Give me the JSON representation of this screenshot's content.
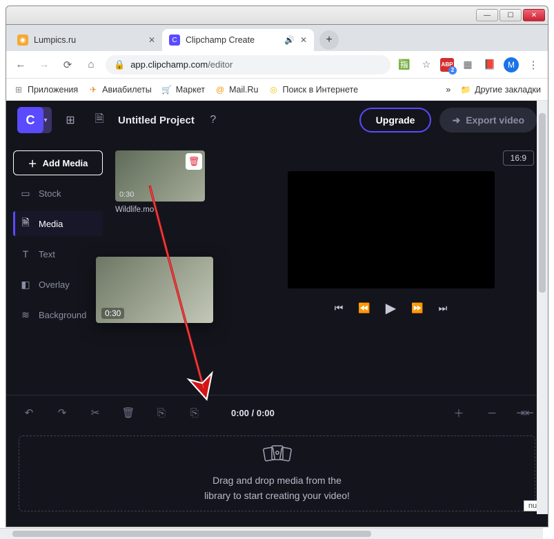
{
  "window": {
    "tabs": [
      {
        "title": "Lumpics.ru",
        "favicon_color": "#f4a934"
      },
      {
        "title": "Clipchamp Create",
        "favicon_color": "#5a4bff",
        "favicon_letter": "C",
        "audio": true
      }
    ]
  },
  "address_bar": {
    "lock": "🔒",
    "host": "app.clipchamp.com",
    "path": "/editor",
    "avatar_letter": "M"
  },
  "bookmarks": {
    "apps": "Приложения",
    "items": [
      {
        "icon": "✈",
        "label": "Авиабилеты",
        "color": "#e88f2a"
      },
      {
        "icon": "🛒",
        "label": "Маркет",
        "color": "#f6b93b"
      },
      {
        "icon": "@",
        "label": "Mail.Ru",
        "color": "#f39c12"
      },
      {
        "icon": "◎",
        "label": "Поиск в Интернете",
        "color": "#f1c40f"
      }
    ],
    "overflow": "»",
    "other": "Другие закладки"
  },
  "app": {
    "project_title": "Untitled Project",
    "upgrade": "Upgrade",
    "export": "Export video",
    "logo_letter": "C",
    "sidebar": {
      "add_media": "Add Media",
      "items": [
        {
          "icon": "▭",
          "label": "Stock"
        },
        {
          "icon": "🗎",
          "label": "Media",
          "active": true
        },
        {
          "icon": "T",
          "label": "Text"
        },
        {
          "icon": "◧",
          "label": "Overlay"
        },
        {
          "icon": "≋",
          "label": "Background"
        }
      ]
    },
    "media": {
      "thumb_duration": "0:30",
      "thumb_name": "Wildlife.mo",
      "drag_duration": "0:30"
    },
    "preview": {
      "aspect": "16:9"
    },
    "timecode": "0:00 / 0:00",
    "dropzone_line1": "Drag and drop media from the",
    "dropzone_line2": "library to start creating your video!",
    "null_badge": "null"
  }
}
